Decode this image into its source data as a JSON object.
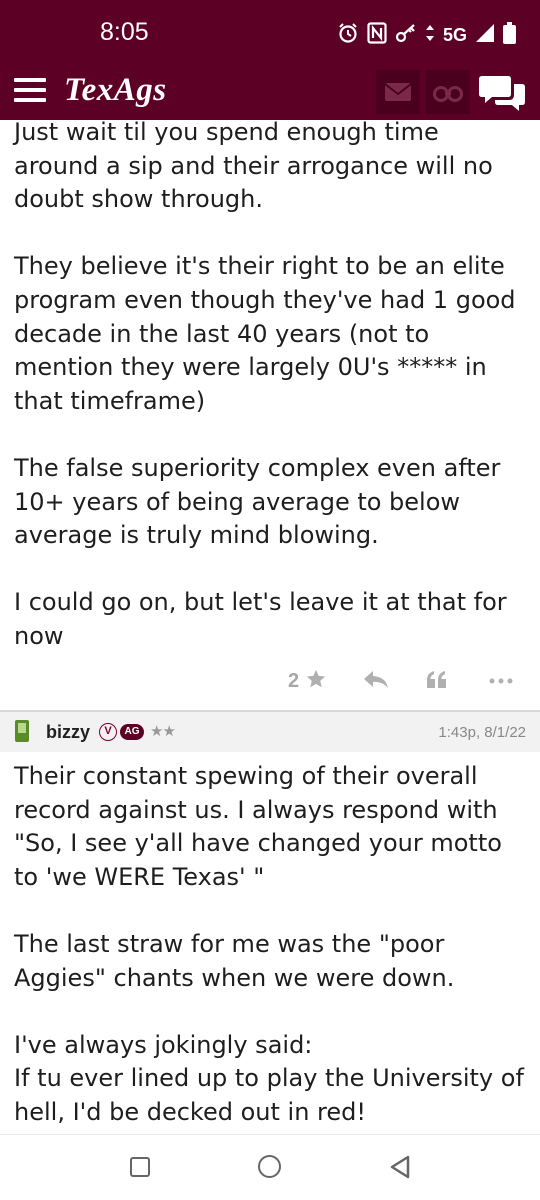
{
  "status": {
    "time": "8:05",
    "network": "5G",
    "icons": [
      "alarm-icon",
      "nfc-icon",
      "key-icon",
      "data-arrows-icon",
      "signal-icon",
      "battery-icon"
    ]
  },
  "app": {
    "logo": "TexAgs",
    "brand_color": "#5d0025",
    "buttons": [
      "menu-icon",
      "mail-icon",
      "binoculars-icon",
      "chat-icon"
    ]
  },
  "post1": {
    "paragraphs": [
      "Just wait til you spend enough time around a sip and their arrogance will no doubt show through.",
      "They believe it's their right to be an elite program even though they've had 1 good decade in the last 40 years (not to mention they were largely 0U's ***** in that timeframe)",
      "The false superiority complex even after 10+ years of being average to below average is truly mind blowing.",
      "I could go on, but let's leave it at that for now"
    ],
    "star_count": "2"
  },
  "post2": {
    "username": "bizzy",
    "badge_v": "V",
    "badge_ag": "AG",
    "stars": "★★",
    "timestamp": "1:43p, 8/1/22",
    "paragraphs": [
      "Their constant spewing of their overall record against us. I always respond with \"So, I see y'all have changed your motto to 'we WERE Texas' \"",
      "The last straw for me was the \"poor Aggies\" chants when we were down.",
      "I've always jokingly said:\nIf tu ever lined up to play the University of hell, I'd be decked out in red!"
    ]
  }
}
